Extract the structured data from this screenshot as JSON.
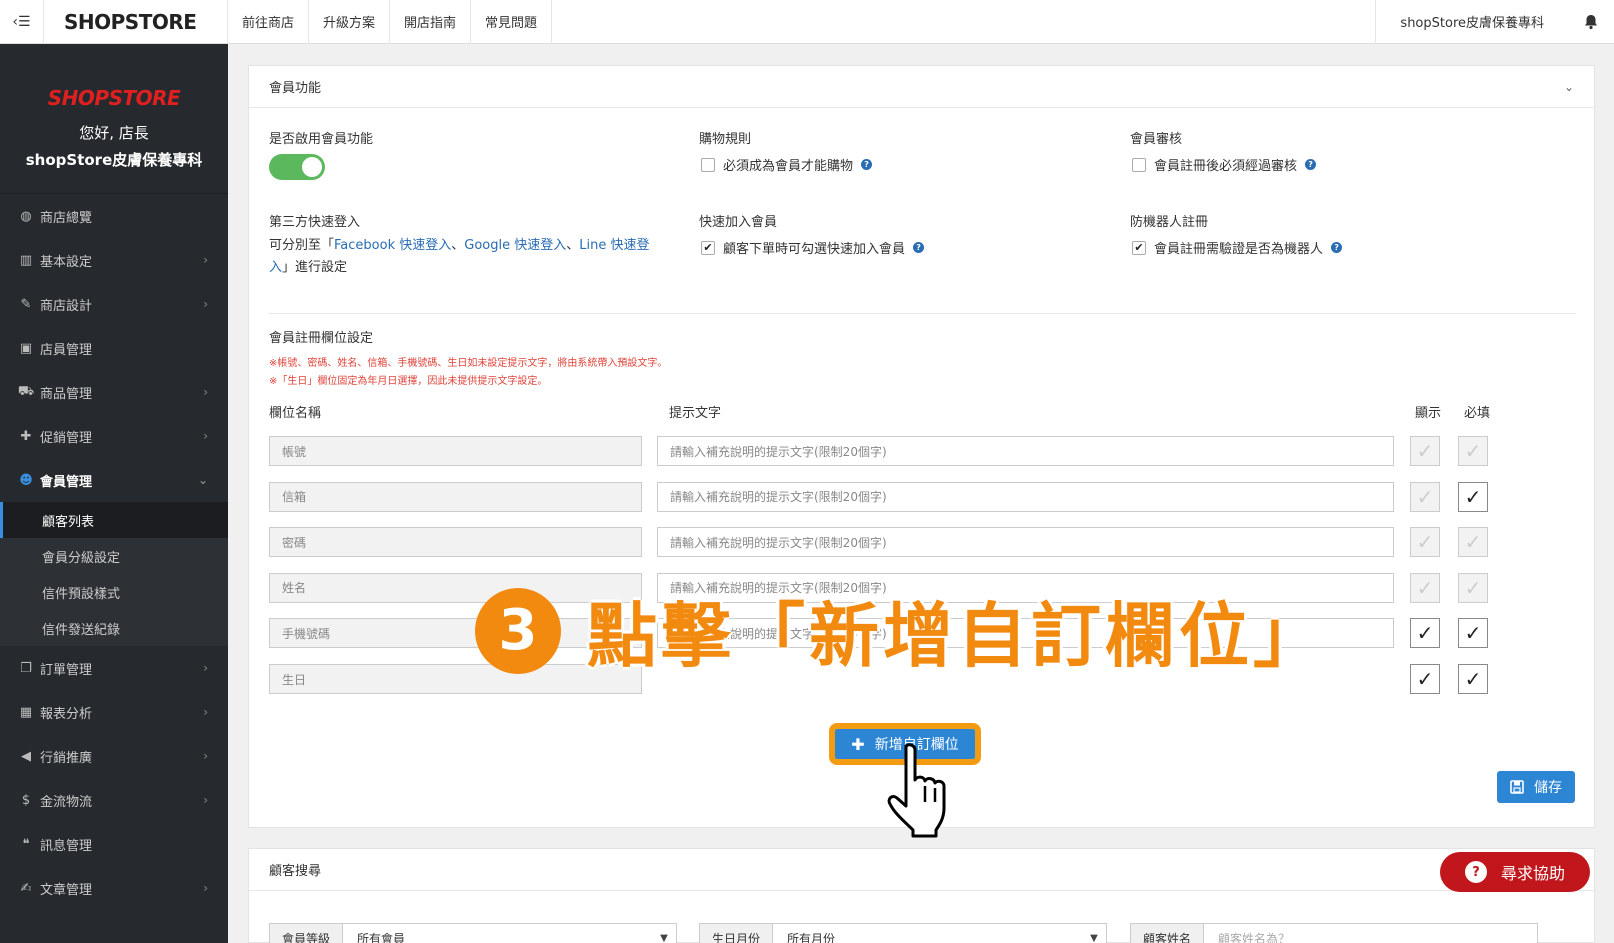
{
  "topbar": {
    "logo": "SHOPSTORE",
    "nav": [
      "前往商店",
      "升級方案",
      "開店指南",
      "常見問題"
    ],
    "store_name": "shopStore皮膚保養專科"
  },
  "sidebar": {
    "brand": "SHOPSTORE",
    "greeting": "您好, 店長",
    "shop": "shopStore皮膚保養專科",
    "items": [
      {
        "label": "商店總覽",
        "icon": "dashboard-icon",
        "glyph": "◍",
        "chevron": false
      },
      {
        "label": "基本設定",
        "icon": "bank-icon",
        "glyph": "▥",
        "chevron": true
      },
      {
        "label": "商店設計",
        "icon": "magic-wand-icon",
        "glyph": "✎",
        "chevron": true
      },
      {
        "label": "店員管理",
        "icon": "lock-icon",
        "glyph": "▣",
        "chevron": false
      },
      {
        "label": "商品管理",
        "icon": "cart-icon",
        "glyph": "⛟",
        "chevron": true
      },
      {
        "label": "促銷管理",
        "icon": "gift-icon",
        "glyph": "✚",
        "chevron": true
      },
      {
        "label": "會員管理",
        "icon": "users-icon",
        "glyph": "☻",
        "chevron": true,
        "active": true
      }
    ],
    "submenu": [
      "顧客列表",
      "會員分級設定",
      "信件預設樣式",
      "信件發送紀錄"
    ],
    "items_after": [
      {
        "label": "訂單管理",
        "icon": "copy-icon",
        "glyph": "❐",
        "chevron": true
      },
      {
        "label": "報表分析",
        "icon": "bar-chart-icon",
        "glyph": "▦",
        "chevron": true
      },
      {
        "label": "行銷推廣",
        "icon": "bullhorn-icon",
        "glyph": "◀",
        "chevron": true
      },
      {
        "label": "金流物流",
        "icon": "dollar-icon",
        "glyph": "$",
        "chevron": true
      },
      {
        "label": "訊息管理",
        "icon": "comments-icon",
        "glyph": "❝",
        "chevron": false
      },
      {
        "label": "文章管理",
        "icon": "edit-icon",
        "glyph": "✍",
        "chevron": true
      }
    ]
  },
  "panel": {
    "title": "會員功能",
    "enable_label": "是否啟用會員功能",
    "enable_on": true,
    "shopping_rule_label": "購物規則",
    "shopping_rule_option": "必須成為會員才能購物",
    "review_label": "會員審核",
    "review_option": "會員註冊後必須經過審核",
    "third_party_label": "第三方快速登入",
    "third_party_prefix": "可分別至「",
    "third_party_fb": "Facebook 快速登入",
    "third_party_sep1": "、",
    "third_party_google": "Google 快速登入",
    "third_party_sep2": "、",
    "third_party_line": "Line 快速登",
    "third_party_line2": "入",
    "third_party_suffix": "」進行設定",
    "quick_join_label": "快速加入會員",
    "quick_join_option": "顧客下單時可勾選快速加入會員",
    "anti_bot_label": "防機器人註冊",
    "anti_bot_option": "會員註冊需驗證是否為機器人",
    "reg_fields_label": "會員註冊欄位設定",
    "note1": "※帳號、密碼、姓名、信箱、手機號碼、生日如未設定提示文字，將由系統帶入預設文字。",
    "note2": "※「生日」欄位固定為年月日選擇，因此未提供提示文字設定。",
    "col_name": "欄位名稱",
    "col_hint": "提示文字",
    "col_show": "顯示",
    "col_required": "必填",
    "rows": [
      {
        "name": "帳號",
        "hint": "請輸入補充說明的提示文字(限制20個字)",
        "show": false,
        "required": false
      },
      {
        "name": "信箱",
        "hint": "請輸入補充說明的提示文字(限制20個字)",
        "show": false,
        "required": true
      },
      {
        "name": "密碼",
        "hint": "請輸入補充說明的提示文字(限制20個字)",
        "show": false,
        "required": false
      },
      {
        "name": "姓名",
        "hint": "請輸入補充說明的提示文字(限制20個字)",
        "show": false,
        "required": false
      },
      {
        "name": "手機號碼",
        "hint": "請輸入補充說明的提示文字(限制20個字)",
        "show": true,
        "required": true
      },
      {
        "name": "生日",
        "hint": "",
        "show": true,
        "required": true
      }
    ],
    "add_button": "新增自訂欄位",
    "save_button": "儲存"
  },
  "overlay": {
    "step_number": "3",
    "step_text": "點擊「新增自訂欄位」"
  },
  "search_panel": {
    "title": "顧客搜尋",
    "level_label": "會員等級",
    "level_value": "所有會員",
    "birth_label": "生日月份",
    "birth_value": "所有月份",
    "name_label": "顧客姓名",
    "name_placeholder": "顧客姓名為？"
  },
  "help_bubble": "尋求協助",
  "colors": {
    "accent": "#2d86d4",
    "sidebar_bg": "#26292d",
    "brand_red": "#e02020",
    "overlay_orange": "#f28a10",
    "switch_green": "#5cb85c",
    "help_red": "#c0161c"
  }
}
